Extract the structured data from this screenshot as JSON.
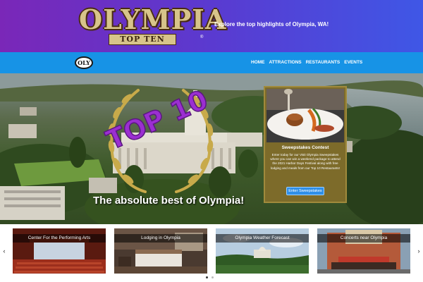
{
  "header": {
    "logo_main": "OLYMPIA",
    "logo_sub": "TOP TEN",
    "logo_tm": "®",
    "tagline": "Explore the top highlights of Olympia, WA!"
  },
  "nav": {
    "logo": "OLY",
    "links": [
      "HOME",
      "ATTRACTIONS",
      "RESTAURANTS",
      "EVENTS"
    ]
  },
  "hero": {
    "badge": "TOP 10",
    "tagline": "The absolute best of Olympia!"
  },
  "contest": {
    "title": "Sweepstakes Contest",
    "text": "Enter today for our Visit Olympia Sweepstakes where you can win a weekend package to attend the 2021 Harbor Days Festival along with free lodging and meals from our Top 10 Restaurants!",
    "button": "Enter Sweepstakes"
  },
  "carousel": {
    "prev": "‹",
    "next": "›",
    "cards": [
      "Center For the Performing Arts",
      "Lodging in Olympia",
      "Olympia Weather Forecast",
      "Concerts near Olympia"
    ]
  },
  "colors": {
    "header_start": "#7a27b8",
    "header_end": "#3f57e6",
    "nav": "#1793e6",
    "badge_text": "#9b2fd1",
    "laurel": "#c8aa4a",
    "contest_bg": "#7d6b2a"
  }
}
